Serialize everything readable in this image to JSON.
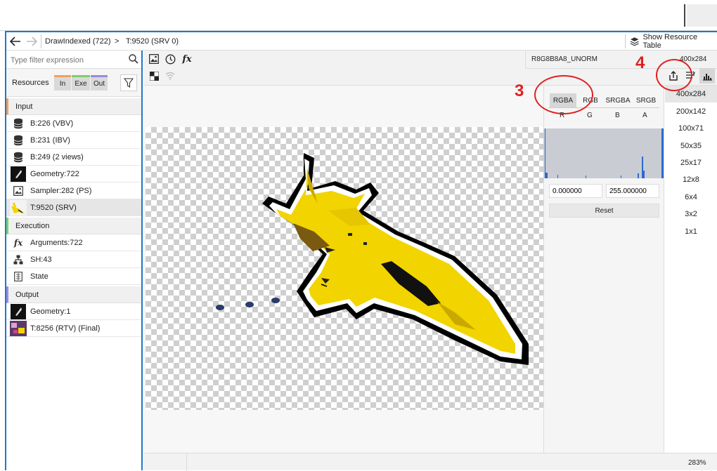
{
  "nav": {
    "breadcrumb_1": "DrawIndexed (722)",
    "breadcrumb_sep": ">",
    "breadcrumb_2": "T:9520 (SRV 0)",
    "show_resource_table": "Show Resource Table"
  },
  "sidebar": {
    "filter_placeholder": "Type filter expression",
    "resources_label": "Resources",
    "toggles": [
      "In",
      "Exe",
      "Out"
    ],
    "sections": {
      "input": "Input",
      "execution": "Execution",
      "output": "Output"
    },
    "input_items": [
      {
        "label": "B:226 (VBV)",
        "icon": "database-icon"
      },
      {
        "label": "B:231 (IBV)",
        "icon": "database-icon"
      },
      {
        "label": "B:249 (2 views)",
        "icon": "database-icon"
      },
      {
        "label": "Geometry:722",
        "icon": "geometry-thumbnail-icon"
      },
      {
        "label": "Sampler:282 (PS)",
        "icon": "image-icon"
      },
      {
        "label": "T:9520 (SRV)",
        "icon": "texture-thumbnail-icon"
      }
    ],
    "execution_items": [
      {
        "label": "Arguments:722",
        "icon": "function-icon"
      },
      {
        "label": "SH:43",
        "icon": "shader-tree-icon"
      },
      {
        "label": "State",
        "icon": "state-icon"
      }
    ],
    "output_items": [
      {
        "label": "Geometry:1",
        "icon": "geometry-thumbnail-icon"
      },
      {
        "label": "T:8256 (RTV) (Final)",
        "icon": "render-target-thumbnail-icon"
      }
    ]
  },
  "viewer": {
    "format": "R8G8B8A8_UNORM",
    "size": "400x284",
    "zoom": "283%"
  },
  "channels": {
    "modes": [
      "RGBA",
      "RGB",
      "SRGBA",
      "SRGB"
    ],
    "selected_mode": "RGBA",
    "components": [
      "R",
      "G",
      "B",
      "A"
    ],
    "range_min": "0.000000",
    "range_max": "255.000000",
    "reset_label": "Reset"
  },
  "mips": {
    "levels": [
      "400x284",
      "200x142",
      "100x71",
      "50x35",
      "25x17",
      "12x8",
      "6x4",
      "3x2",
      "1x1"
    ],
    "selected": "400x284"
  },
  "annotations": {
    "marker_3": "3",
    "marker_4": "4"
  },
  "colors": {
    "accent": "#0078d4",
    "annotation_red": "#e02020",
    "texture_yellow": "#f2d400",
    "selected_row": "#e6e6e6"
  }
}
